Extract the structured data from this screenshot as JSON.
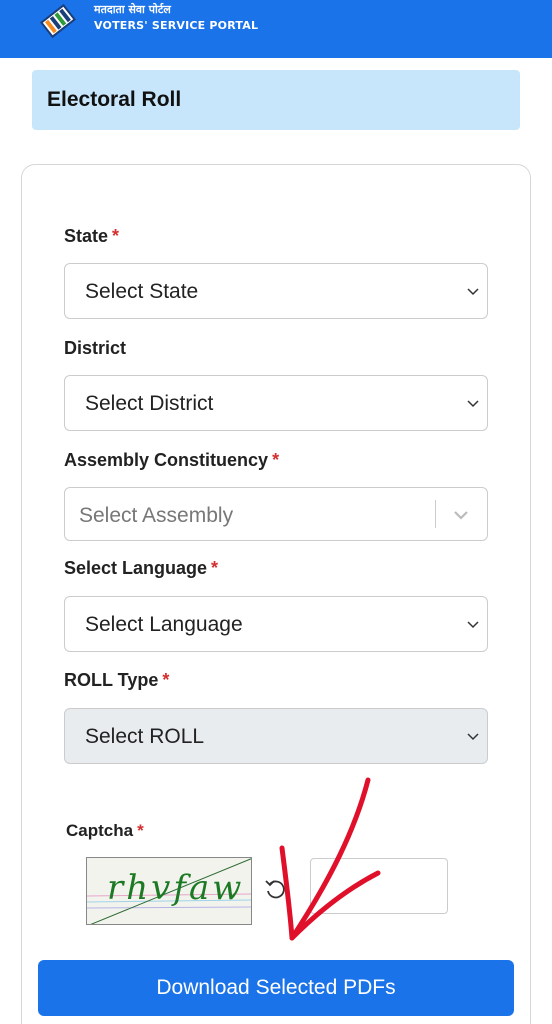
{
  "header": {
    "brand_hindi": "मतदाता सेवा पोर्टल",
    "brand_english": "VOTERS' SERVICE PORTAL",
    "logo_icon": "eci-logo-icon",
    "bg_color": "#1a73e8"
  },
  "page": {
    "title": "Electoral Roll",
    "title_bg": "#c8e6fb"
  },
  "form": {
    "required_marker": "*",
    "state": {
      "label": "State",
      "required": true,
      "value": "Select State"
    },
    "district": {
      "label": "District",
      "required": false,
      "value": "Select District"
    },
    "assembly": {
      "label": "Assembly Constituency",
      "required": true,
      "placeholder": "Select Assembly"
    },
    "language": {
      "label": "Select Language",
      "required": true,
      "value": "Select Language"
    },
    "roll_type": {
      "label": "ROLL Type",
      "required": true,
      "value": "Select ROLL",
      "disabled": true
    },
    "captcha": {
      "label": "Captcha",
      "required": true,
      "image_text": "rhvfaw",
      "input_value": ""
    },
    "download_button": "Download Selected PDFs"
  },
  "colors": {
    "primary": "#1a73e8",
    "required": "#d32f2f",
    "captcha_text": "#1c7a24",
    "annotation_arrow": "#e0102a"
  }
}
